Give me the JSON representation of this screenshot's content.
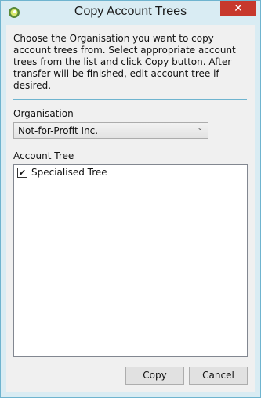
{
  "window": {
    "title": "Copy Account Trees",
    "close_glyph": "✕",
    "icon": "app-globe-icon"
  },
  "description": "Choose the Organisation you want to copy account trees from. Select appropriate account trees from the list and click Copy button. After transfer will be finished, edit account tree if desired.",
  "organisation": {
    "label": "Organisation",
    "selected": "Not-for-Profit Inc."
  },
  "account_tree": {
    "label": "Account Tree",
    "items": [
      {
        "label": "Specialised Tree",
        "checked": true
      }
    ]
  },
  "buttons": {
    "copy": "Copy",
    "cancel": "Cancel"
  },
  "colors": {
    "frame": "#d9ecf3",
    "close": "#c7382c",
    "accent_rule": "#6fb4cf"
  }
}
